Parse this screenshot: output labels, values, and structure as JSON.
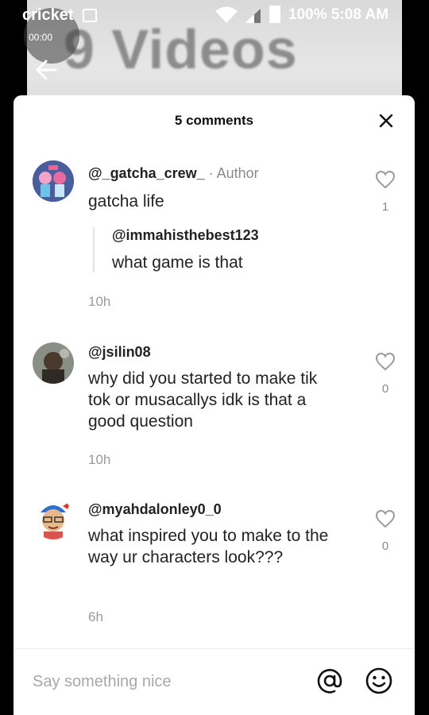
{
  "status_bar": {
    "carrier": "cricket",
    "battery_and_time": "100% 5:08 AM",
    "recording_time": "00:00"
  },
  "video": {
    "title_text": "9 Videos"
  },
  "sheet": {
    "title": "5 comments"
  },
  "comments": [
    {
      "username": "@_gatcha_crew_",
      "author_tag": " · Author",
      "text": "gatcha life",
      "likes": "1",
      "reply": {
        "username": "@immahisthebest123",
        "text": "what game is that"
      },
      "time": "10h"
    },
    {
      "username": "@jsilin08",
      "text": "why did you started to make tik tok or musacallys idk is that a good question",
      "likes": "0",
      "time": "10h"
    },
    {
      "username": "@myahdalonley0_0",
      "text": "what inspired you to make to the way ur characters look???",
      "likes": "0",
      "time": "6h"
    }
  ],
  "input": {
    "placeholder": "Say something nice"
  },
  "icons": [
    "wifi-icon",
    "signal-icon",
    "battery-icon",
    "close-icon",
    "heart-icon",
    "at-icon",
    "emoji-icon",
    "back-arrow-icon"
  ]
}
